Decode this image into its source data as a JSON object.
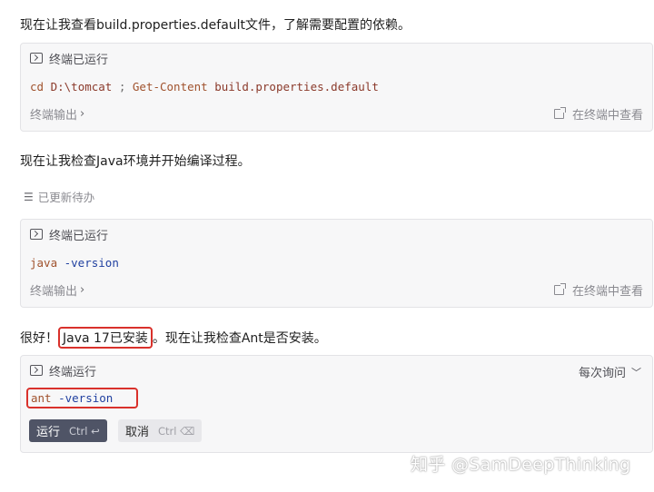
{
  "messages": {
    "msg1": "现在让我查看build.properties.default文件，了解需要配置的依赖。",
    "msg2": "现在让我检查Java环境并开始编译过程。",
    "msg3_prefix": "很好！",
    "msg3_highlight": "Java 17已安装",
    "msg3_suffix": "。现在让我检查Ant是否安装。"
  },
  "todo": {
    "label": "已更新待办"
  },
  "terminal1": {
    "header": "终端已运行",
    "cmd_part1": "cd",
    "cmd_part2": " D:\\tomcat",
    "cmd_part3": " ; ",
    "cmd_part4": "Get-Content",
    "cmd_part5": " build.properties.default",
    "output_label": "终端输出",
    "view_label": "在终端中查看"
  },
  "terminal2": {
    "header": "终端已运行",
    "cmd_name": "java",
    "cmd_flag": " -version",
    "output_label": "终端输出",
    "view_label": "在终端中查看"
  },
  "terminal3": {
    "header": "终端运行",
    "ask_label": "每次询问",
    "cmd_name": "ant",
    "cmd_flag": " -version",
    "run_label": "运行",
    "run_shortcut": "Ctrl ↩",
    "cancel_label": "取消",
    "cancel_shortcut": "Ctrl ⌫"
  },
  "watermark": {
    "text": "知乎 @SamDeepThinking"
  },
  "colors": {
    "highlight_border": "#d9312b",
    "run_button": "#4f5466"
  }
}
